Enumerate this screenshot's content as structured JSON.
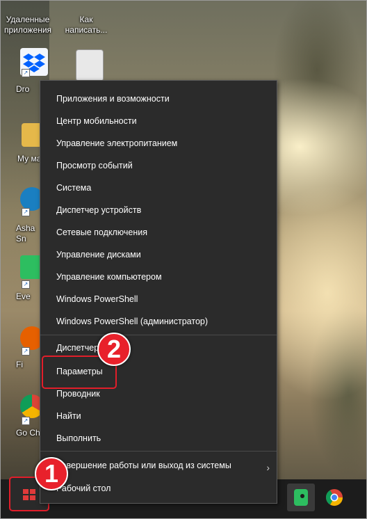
{
  "desktop": {
    "icons": [
      {
        "label": "Удаленные приложения"
      },
      {
        "label": "Как написать..."
      },
      {
        "label": "Dro"
      },
      {
        "label": "Му ма"
      },
      {
        "label": "Asha Sn"
      },
      {
        "label": "Eve"
      },
      {
        "label": "Fi"
      },
      {
        "label": "Go Ch"
      }
    ]
  },
  "context_menu": {
    "items": [
      "Приложения и возможности",
      "Центр мобильности",
      "Управление электропитанием",
      "Просмотр событий",
      "Система",
      "Диспетчер устройств",
      "Сетевые подключения",
      "Управление дисками",
      "Управление компьютером",
      "Windows PowerShell",
      "Windows PowerShell (администратор)",
      "Диспетчер",
      "Параметры",
      "Проводник",
      "Найти",
      "Выполнить",
      "Завершение работы или выход из системы",
      "Рабочий стол"
    ]
  },
  "callouts": {
    "step1": "1",
    "step2": "2"
  },
  "colors": {
    "menu_bg": "#2b2b2b",
    "callout_red": "#e21e2a",
    "taskbar_bg": "#1c1c1c"
  },
  "icons": {
    "start": "windows-logo-icon",
    "submenu": "chevron-right-icon",
    "evernote": "evernote-icon",
    "chrome": "chrome-icon"
  }
}
